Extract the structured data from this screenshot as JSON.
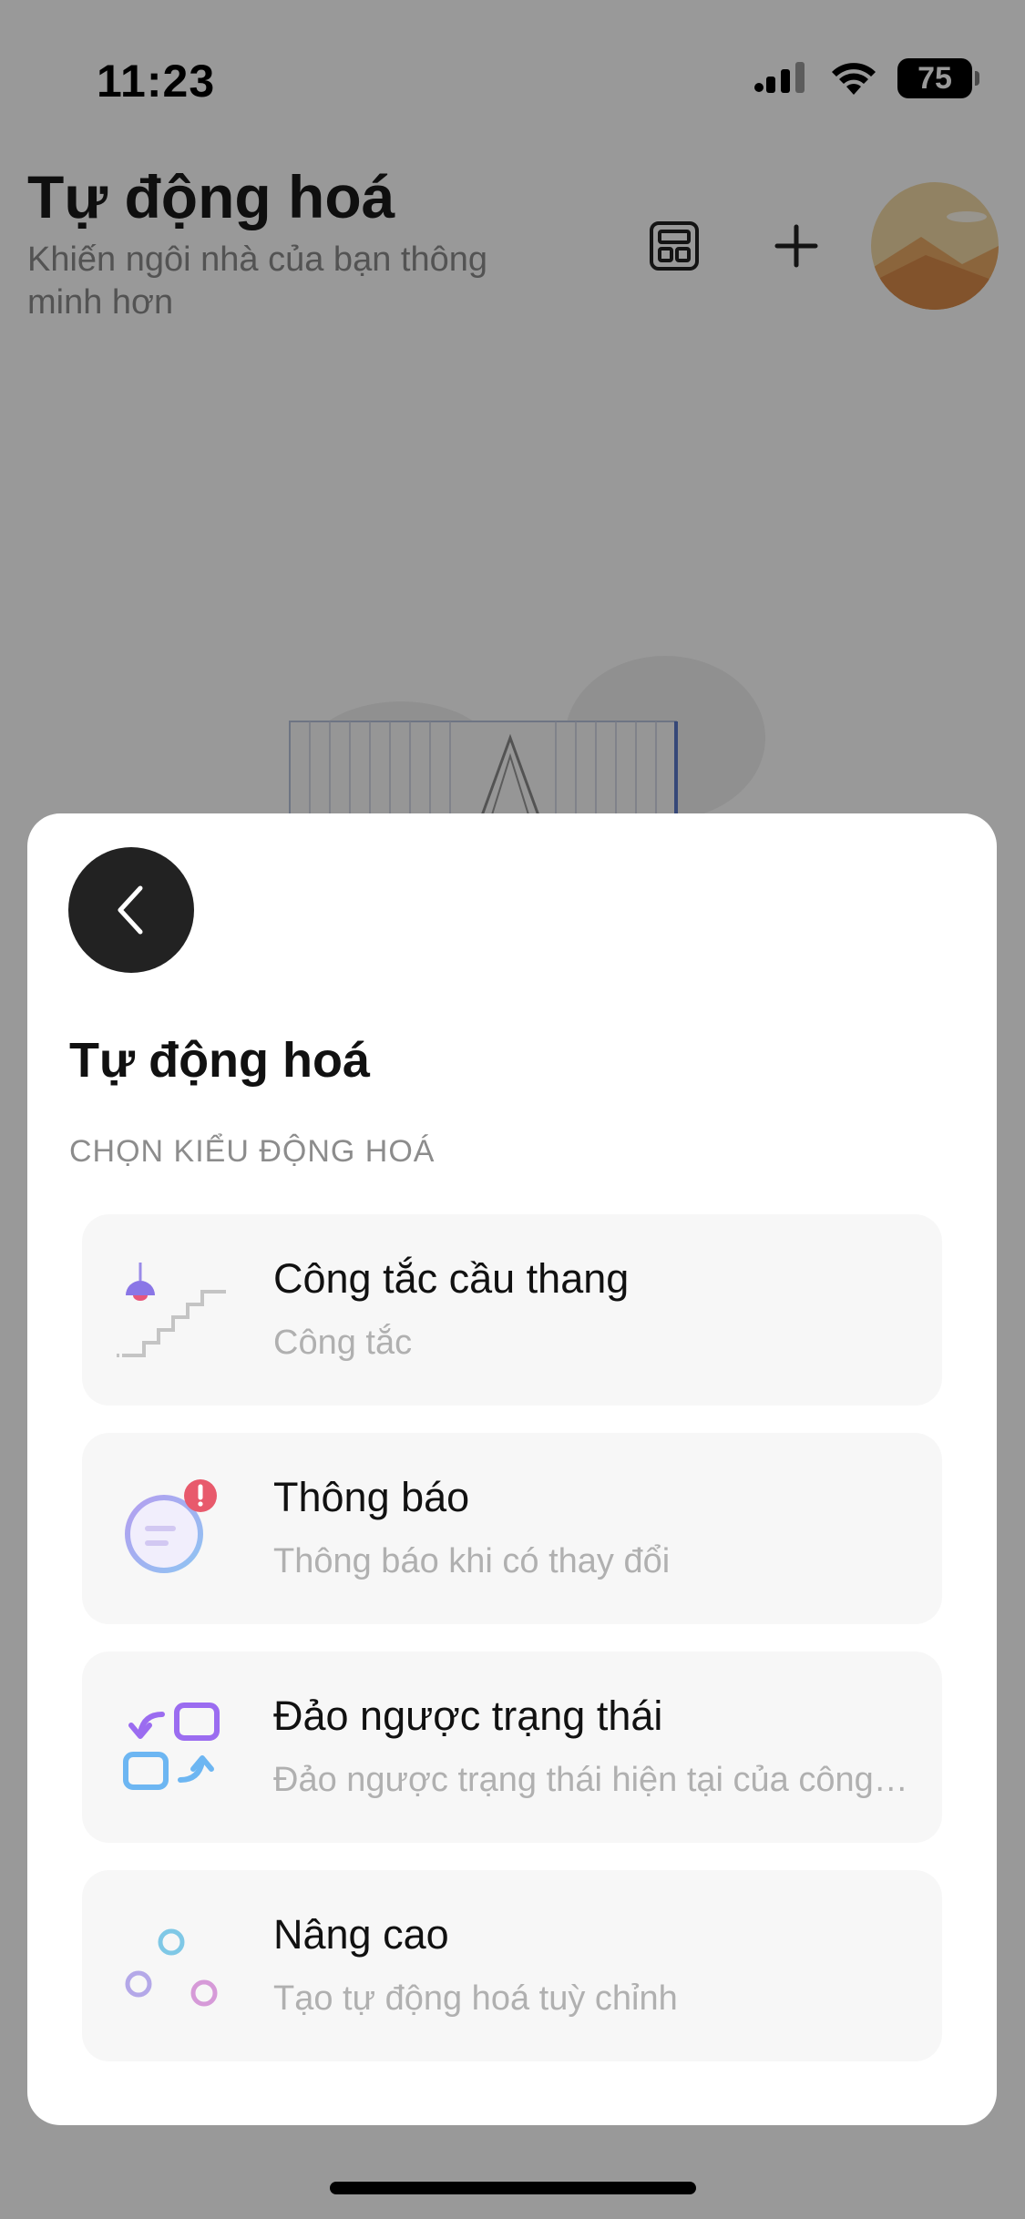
{
  "status_bar": {
    "time": "11:23",
    "battery": "75",
    "icons": [
      "signal-icon",
      "wifi-icon",
      "battery-icon"
    ]
  },
  "header": {
    "title": "Tự động hoá",
    "subtitle": "Khiến ngôi nhà của bạn thông minh hơn",
    "actions": [
      "layout-grid-icon",
      "add-icon",
      "avatar"
    ]
  },
  "sheet": {
    "back_icon": "chevron-left-icon",
    "title": "Tự động hoá",
    "section_label": "CHỌN KIỂU ĐỘNG HOÁ",
    "options": [
      {
        "title": "Công tắc cầu thang",
        "description": "Công tắc",
        "icon": "staircase-lamp-icon"
      },
      {
        "title": "Thông báo",
        "description": "Thông báo khi có thay đổi",
        "icon": "notification-icon"
      },
      {
        "title": "Đảo ngược trạng thái",
        "description": "Đảo ngược trạng thái hiện tại của công tắc",
        "icon": "swap-state-icon"
      },
      {
        "title": "Nâng cao",
        "description": "Tạo tự động hoá tuỳ chỉnh",
        "icon": "sliders-icon"
      }
    ]
  },
  "colors": {
    "overlay": "#00000066",
    "sheet_bg": "#ffffff",
    "card_bg": "#f7f7f7",
    "back_button": "#222222",
    "accent_purple": "#9b6cf0",
    "accent_blue": "#6db6f2",
    "alert_red": "#e85a6c"
  }
}
